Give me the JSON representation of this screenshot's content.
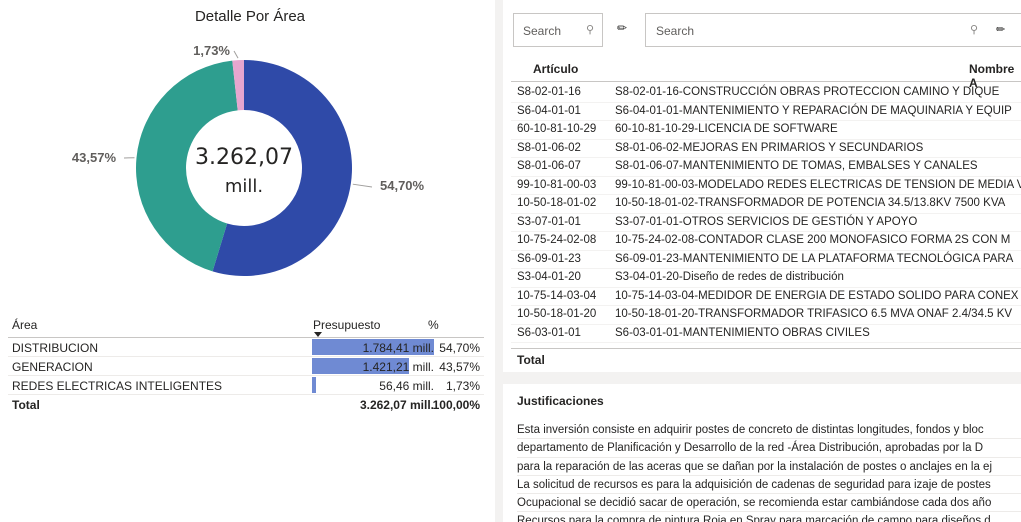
{
  "left_panel": {
    "title": "Detalle Por Área",
    "chart_data": {
      "type": "pie",
      "title": "Detalle Por Área",
      "center_value": "3.262,07",
      "center_unit": "mill.",
      "categories": [
        "DISTRIBUCION",
        "GENERACION",
        "REDES ELECTRICAS INTELIGENTES"
      ],
      "values": [
        54.7,
        43.57,
        1.73
      ],
      "labels": [
        "54,70%",
        "43,57%",
        "1,73%"
      ],
      "colors": [
        "#2f4aa8",
        "#2e9e8f",
        "#e6a6cf"
      ]
    },
    "table": {
      "headers": {
        "area": "Área",
        "presupuesto": "Presupuesto",
        "pct": "%"
      },
      "rows": [
        {
          "area": "DISTRIBUCION",
          "presupuesto": "1.784,41 mill.",
          "pct": "54,70%",
          "bar": 1.0
        },
        {
          "area": "GENERACION",
          "presupuesto": "1.421,21 mill.",
          "pct": "43,57%",
          "bar": 0.796
        },
        {
          "area": "REDES ELECTRICAS INTELIGENTES",
          "presupuesto": "56,46 mill.",
          "pct": "1,73%",
          "bar": 0.032
        }
      ],
      "total": {
        "label": "Total",
        "presupuesto": "3.262,07 mill.",
        "pct": "100,00%"
      }
    }
  },
  "right_panel": {
    "search1_placeholder": "Search",
    "search2_placeholder": "Search",
    "table": {
      "headers": {
        "articulo": "Artículo",
        "nombre": "Nombre A"
      },
      "rows": [
        {
          "articulo": "S8-02-01-16",
          "nombre": "S8-02-01-16-CONSTRUCCIÓN OBRAS PROTECCION CAMINO Y DIQUE"
        },
        {
          "articulo": "S6-04-01-01",
          "nombre": "S6-04-01-01-MANTENIMIENTO Y REPARACIÓN DE MAQUINARIA Y EQUIP"
        },
        {
          "articulo": "60-10-81-10-29",
          "nombre": "60-10-81-10-29-LICENCIA DE SOFTWARE"
        },
        {
          "articulo": "S8-01-06-02",
          "nombre": "S8-01-06-02-MEJORAS EN PRIMARIOS Y SECUNDARIOS"
        },
        {
          "articulo": "S8-01-06-07",
          "nombre": "S8-01-06-07-MANTENIMIENTO DE TOMAS, EMBALSES Y CANALES"
        },
        {
          "articulo": "99-10-81-00-03",
          "nombre": "99-10-81-00-03-MODELADO REDES ELECTRICAS DE TENSION DE MEDIA V"
        },
        {
          "articulo": "10-50-18-01-02",
          "nombre": "10-50-18-01-02-TRANSFORMADOR DE POTENCIA 34.5/13.8KV 7500 KVA"
        },
        {
          "articulo": "S3-07-01-01",
          "nombre": "S3-07-01-01-OTROS SERVICIOS DE GESTIÓN Y APOYO"
        },
        {
          "articulo": "10-75-24-02-08",
          "nombre": "10-75-24-02-08-CONTADOR CLASE 200 MONOFASICO FORMA 2S CON M"
        },
        {
          "articulo": "S6-09-01-23",
          "nombre": "S6-09-01-23-MANTENIMIENTO DE LA PLATAFORMA TECNOLÓGICA PARA"
        },
        {
          "articulo": "S3-04-01-20",
          "nombre": "S3-04-01-20-Diseño de redes de distribución"
        },
        {
          "articulo": "10-75-14-03-04",
          "nombre": "10-75-14-03-04-MEDIDOR DE ENERGIA DE ESTADO SOLIDO PARA CONEX"
        },
        {
          "articulo": "10-50-18-01-20",
          "nombre": "10-50-18-01-20-TRANSFORMADOR TRIFASICO 6.5 MVA ONAF 2.4/34.5 KV"
        },
        {
          "articulo": "S6-03-01-01",
          "nombre": "S6-03-01-01-MANTENIMIENTO OBRAS CIVILES"
        }
      ],
      "total_label": "Total"
    },
    "justificaciones": {
      "title": "Justificaciones",
      "lines": [
        "Esta inversión consiste en adquirir postes de concreto de distintas longitudes, fondos y bloc",
        "departamento de Planificación y Desarrollo de la red -Área Distribución, aprobadas por la D",
        "para la reparación de las aceras que se dañan por la instalación de postes o anclajes en la ej",
        "La solicitud de recursos es para la adquisición de cadenas de seguridad para izaje de postes",
        "Ocupacional se decidió sacar de operación, se recomienda estar cambiándose cada dos año",
        "Recursos para la compra de pintura Roja en Spray para marcación de campo para diseños d"
      ]
    }
  }
}
